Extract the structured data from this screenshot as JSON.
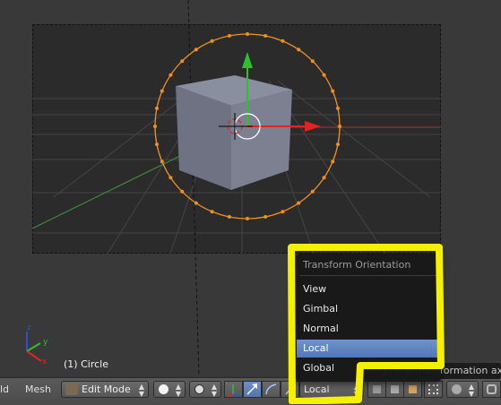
{
  "viewport": {
    "object_label": "(1) Circle",
    "axis_x": "x",
    "axis_y": "y",
    "axis_z": "z"
  },
  "menu": {
    "title": "Transform Orientation",
    "items": [
      {
        "label": "View",
        "highlighted": false
      },
      {
        "label": "Gimbal",
        "highlighted": false
      },
      {
        "label": "Normal",
        "highlighted": false
      },
      {
        "label": "Local",
        "highlighted": true
      },
      {
        "label": "Global",
        "highlighted": false
      }
    ]
  },
  "tooltip": {
    "text": "Align the transformation axes"
  },
  "header": {
    "view_label": "ld",
    "mesh_label": "Mesh",
    "mode_label": "Edit Mode",
    "orientation_value": "Local"
  },
  "colors": {
    "selection_orange": "#f0901e",
    "annotation_yellow": "#f4f000",
    "menu_highlight": "#5f86c1",
    "x_axis": "#e02424",
    "y_axis": "#2ec02e",
    "z_axis": "#3050d0"
  }
}
